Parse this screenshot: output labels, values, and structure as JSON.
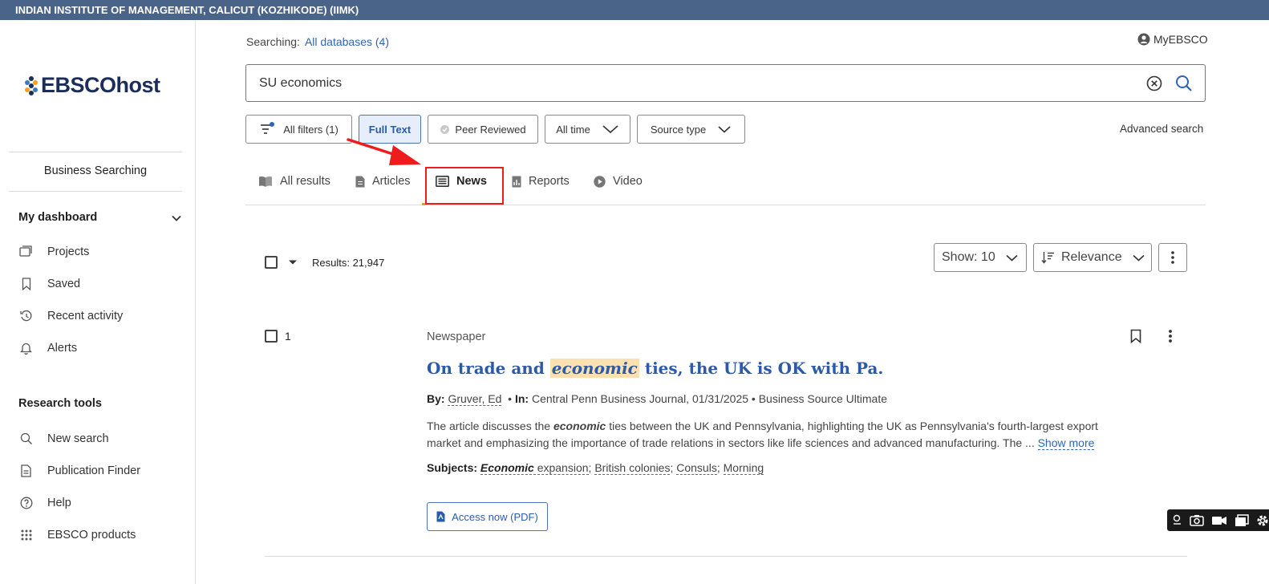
{
  "institution": "INDIAN INSTITUTE OF MANAGEMENT, CALICUT (KOZHIKODE) (IIMK)",
  "logo_text": "EBSCOhost",
  "profile": "Business Searching",
  "sidebar": {
    "dashboard_heading": "My dashboard",
    "dashboard_items": [
      {
        "label": "Projects",
        "icon": "folders-icon"
      },
      {
        "label": "Saved",
        "icon": "bookmark-icon"
      },
      {
        "label": "Recent activity",
        "icon": "history-icon"
      },
      {
        "label": "Alerts",
        "icon": "bell-icon"
      }
    ],
    "tools_heading": "Research tools",
    "tools_items": [
      {
        "label": "New search",
        "icon": "search-icon"
      },
      {
        "label": "Publication Finder",
        "icon": "document-icon"
      },
      {
        "label": "Help",
        "icon": "help-icon"
      },
      {
        "label": "EBSCO products",
        "icon": "grid-icon"
      }
    ]
  },
  "searching": {
    "label": "Searching:",
    "databases": "All databases (4)"
  },
  "myebsco": "MyEBSCO",
  "search": {
    "query": "SU economics"
  },
  "filters": {
    "all_filters": "All filters (1)",
    "full_text": "Full Text",
    "peer_reviewed": "Peer Reviewed",
    "all_time": "All time",
    "source_type": "Source type",
    "advanced_search": "Advanced search"
  },
  "tabs": [
    {
      "label": "All results",
      "icon": "book-icon"
    },
    {
      "label": "Articles",
      "icon": "article-icon"
    },
    {
      "label": "News",
      "icon": "newspaper-icon",
      "active": true
    },
    {
      "label": "Reports",
      "icon": "report-icon"
    },
    {
      "label": "Video",
      "icon": "play-icon"
    }
  ],
  "results": {
    "count": "Results: 21,947",
    "show": "Show: 10",
    "sort": "Relevance"
  },
  "result1": {
    "number": "1",
    "type": "Newspaper",
    "title_before": "On trade and",
    "title_highlight": "economic",
    "title_after": "ties, the UK is OK with Pa.",
    "by_label": "By:",
    "author": "Gruver, Ed",
    "in_label": "In:",
    "source": "Central Penn Business Journal, 01/31/2025",
    "database": "Business Source Ultimate",
    "abstract_before": "The article discusses the",
    "abstract_highlight": "economic",
    "abstract_after": "ties between the UK and Pennsylvania, highlighting the UK as Pennsylvania's fourth-largest export market and emphasizing the importance of trade relations in sectors like life sciences and advanced manufacturing. The ...",
    "show_more": "Show more",
    "subjects_label": "Subjects:",
    "subject1_highlight": "Economic",
    "subject1_rest": "expansion",
    "subject2": "British colonies",
    "subject3": "Consuls",
    "subject4": "Morning",
    "access": "Access now (PDF)"
  },
  "colors": {
    "topbar": "#4a6489",
    "link": "#2f64b5",
    "highlight": "#fbe0b0",
    "annotation": "#ee1c1c"
  }
}
